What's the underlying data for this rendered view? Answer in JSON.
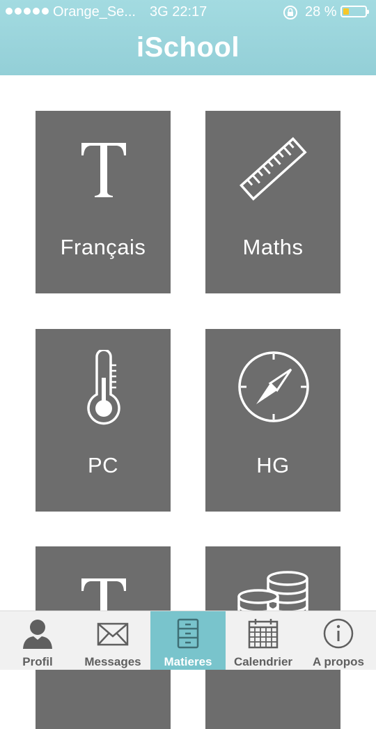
{
  "status_bar": {
    "carrier": "Orange_Se...",
    "network_time": "3G 22:17",
    "battery_percent": "28 %",
    "battery_level": 0.28,
    "lock_icon": "rotation-lock-icon"
  },
  "header": {
    "title": "iSchool"
  },
  "subjects": [
    {
      "label": "Français",
      "icon": "text-t-icon"
    },
    {
      "label": "Maths",
      "icon": "ruler-icon"
    },
    {
      "label": "PC",
      "icon": "thermometer-icon"
    },
    {
      "label": "HG",
      "icon": "compass-icon"
    },
    {
      "label": "",
      "icon": "text-t-icon"
    },
    {
      "label": "",
      "icon": "coin-stacks-icon"
    }
  ],
  "tabbar": {
    "items": [
      {
        "label": "Profil",
        "icon": "profile-icon"
      },
      {
        "label": "Messages",
        "icon": "envelope-icon"
      },
      {
        "label": "Matieres",
        "icon": "cabinet-icon"
      },
      {
        "label": "Calendrier",
        "icon": "calendar-icon"
      },
      {
        "label": "A propos",
        "icon": "info-icon"
      }
    ],
    "active": "Matieres"
  },
  "colors": {
    "header": "#93cfd7",
    "tile": "#6d6d6d",
    "active_tab": "#79c4cc",
    "battery": "#f7c72a"
  }
}
